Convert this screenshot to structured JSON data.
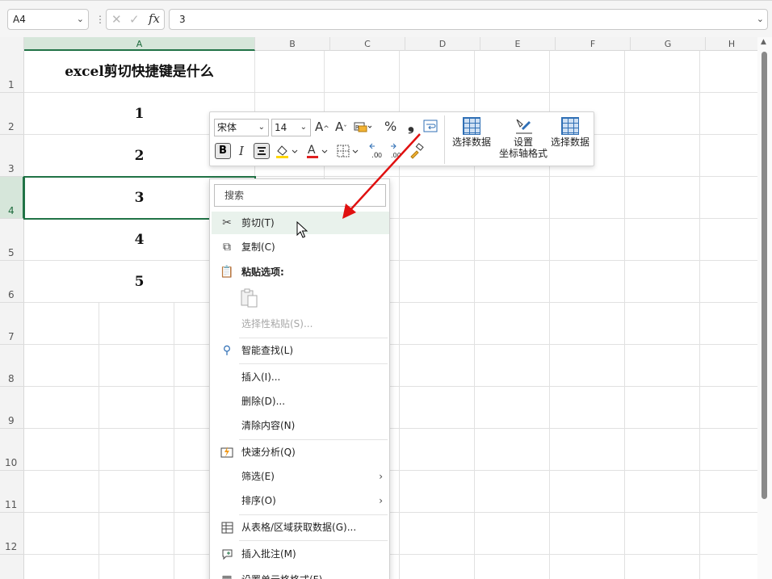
{
  "formula_bar": {
    "name_box": "A4",
    "value": "3",
    "fx_label": "fx"
  },
  "columns": [
    "A",
    "B",
    "C",
    "D",
    "E",
    "F",
    "G",
    "H"
  ],
  "rows": [
    "1",
    "2",
    "3",
    "4",
    "5",
    "6",
    "7",
    "8",
    "9",
    "10",
    "11",
    "12"
  ],
  "cells": {
    "a1": "excel剪切快捷键是什么",
    "a2": "1",
    "a3": "2",
    "a4": "3",
    "a5": "4",
    "a6": "5"
  },
  "mini_toolbar": {
    "font_name": "宋体",
    "font_size": "14",
    "bold": "B",
    "italic": "I",
    "percent": "%",
    "comma": "❟",
    "btn_select_data_1": "选择数据",
    "btn_format_axis_line1": "设置",
    "btn_format_axis_line2": "坐标轴格式",
    "btn_select_data_2": "选择数据",
    "accent_highlight": "#ffd600",
    "accent_font_color": "#e02020"
  },
  "context_menu": {
    "search_placeholder": "搜索",
    "cut": "剪切(T)",
    "copy": "复制(C)",
    "paste_options": "粘贴选项:",
    "paste_special": "选择性粘贴(S)...",
    "smart_lookup": "智能查找(L)",
    "insert": "插入(I)...",
    "delete": "删除(D)...",
    "clear_contents": "清除内容(N)",
    "quick_analysis": "快速分析(Q)",
    "filter": "筛选(E)",
    "sort": "排序(O)",
    "get_data": "从表格/区域获取数据(G)...",
    "insert_comment": "插入批注(M)",
    "format_cells": "设置单元格格式(F)..."
  },
  "colors": {
    "excel_green": "#217346",
    "annotation_arrow": "#e01010"
  }
}
